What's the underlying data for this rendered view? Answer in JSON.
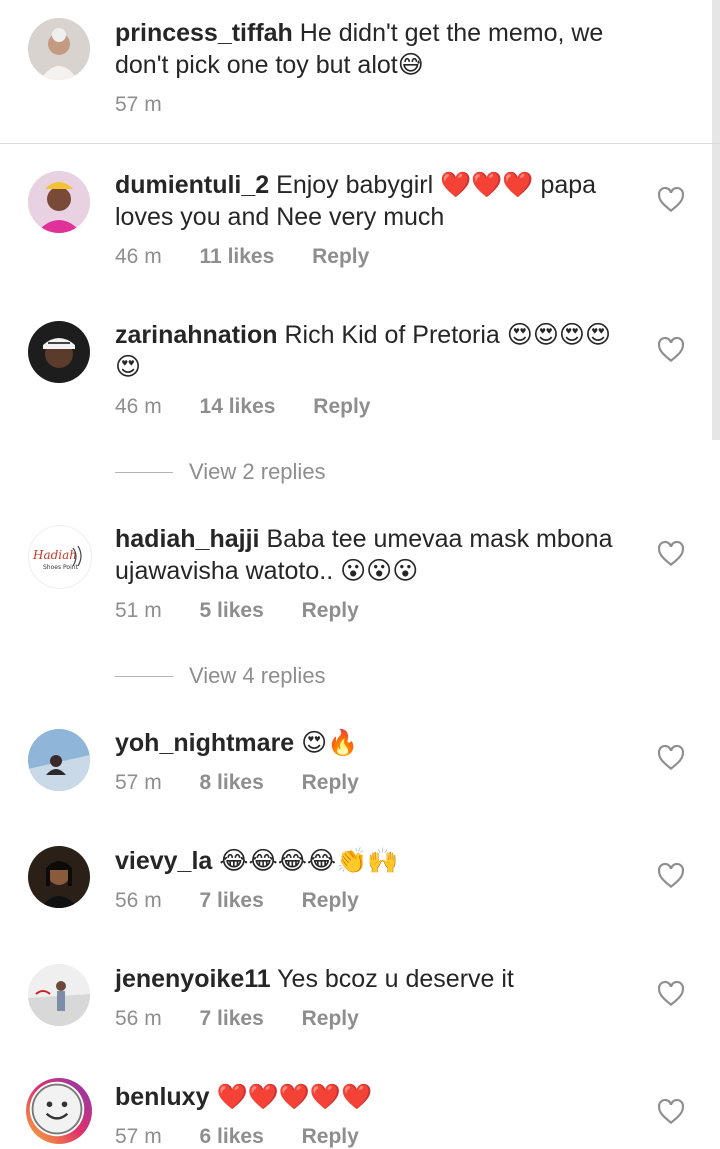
{
  "comments": [
    {
      "username": "princess_tiffah",
      "text": "He didn't get the memo, we don't pick one  toy but alot😅",
      "time": "57 m",
      "likes": "",
      "reply": ""
    },
    {
      "username": "dumientuli_2",
      "text": "Enjoy babygirl ❤️❤️❤️ papa loves you and Nee very much",
      "time": "46 m",
      "likes": "11 likes",
      "reply": "Reply"
    },
    {
      "username": "zarinahnation",
      "text": "Rich Kid of Pretoria 😍😍😍😍😍",
      "time": "46 m",
      "likes": "14 likes",
      "reply": "Reply"
    },
    {
      "username": "hadiah_hajji",
      "text": "Baba tee umevaa mask mbona ujawavisha watoto.. 😮😮😮",
      "time": "51 m",
      "likes": "5 likes",
      "reply": "Reply"
    },
    {
      "username": "yoh_nightmare",
      "text": "😍🔥",
      "time": "57 m",
      "likes": "8 likes",
      "reply": "Reply"
    },
    {
      "username": "vievy_la",
      "text": "😂😂😂😂👏🙌",
      "time": "56 m",
      "likes": "7 likes",
      "reply": "Reply"
    },
    {
      "username": "jenenyoike11",
      "text": "Yes bcoz u deserve it",
      "time": "56 m",
      "likes": "7 likes",
      "reply": "Reply"
    },
    {
      "username": "benluxy",
      "text": "❤️❤️❤️❤️❤️",
      "time": "57 m",
      "likes": "6 likes",
      "reply": "Reply"
    }
  ],
  "view_replies": [
    "View 2 replies",
    "View 4 replies"
  ],
  "avatar_logo_text": "Hadiah Shoes Point",
  "icons": {
    "like": "heart-outline-icon"
  },
  "colors": {
    "text": "#262626",
    "meta": "#8e8e8e",
    "divider": "#dbdbdb",
    "heart": "#e0245e"
  }
}
